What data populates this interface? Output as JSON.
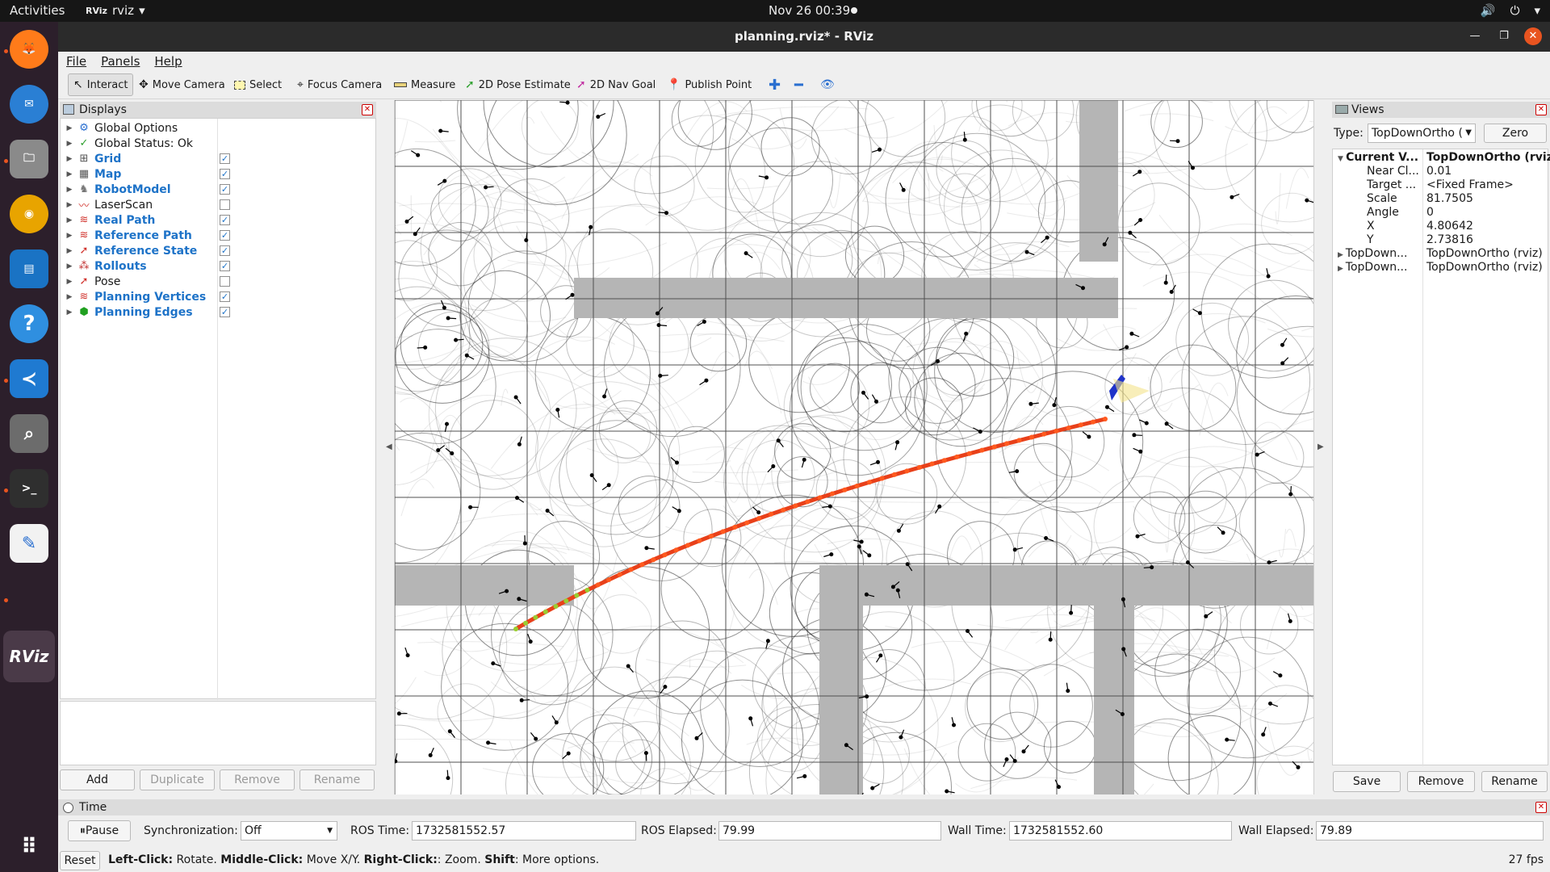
{
  "topbar": {
    "activities": "Activities",
    "app_logo": "RViz",
    "app_name": "rviz",
    "clock": "Nov 26  00:39"
  },
  "window": {
    "title": "planning.rviz* - RViz"
  },
  "menu": [
    "File",
    "Panels",
    "Help"
  ],
  "toolbar": {
    "interact": "Interact",
    "move_camera": "Move Camera",
    "select": "Select",
    "focus_camera": "Focus Camera",
    "measure": "Measure",
    "pose_estimate": "2D Pose Estimate",
    "nav_goal": "2D Nav Goal",
    "publish_point": "Publish Point"
  },
  "displays": {
    "title": "Displays",
    "items": [
      {
        "label": "Global Options",
        "checked": null,
        "highlight": false,
        "icon": "gear-icon"
      },
      {
        "label": "Global Status: Ok",
        "checked": null,
        "highlight": false,
        "icon": "check-icon"
      },
      {
        "label": "Grid",
        "checked": true,
        "highlight": true,
        "icon": "grid-icon"
      },
      {
        "label": "Map",
        "checked": true,
        "highlight": true,
        "icon": "map-icon"
      },
      {
        "label": "RobotModel",
        "checked": true,
        "highlight": true,
        "icon": "robot-icon"
      },
      {
        "label": "LaserScan",
        "checked": false,
        "highlight": false,
        "icon": "laser-icon"
      },
      {
        "label": "Real Path",
        "checked": true,
        "highlight": true,
        "icon": "path-icon"
      },
      {
        "label": "Reference Path",
        "checked": true,
        "highlight": true,
        "icon": "path-icon"
      },
      {
        "label": "Reference State",
        "checked": true,
        "highlight": true,
        "icon": "pose-icon"
      },
      {
        "label": "Rollouts",
        "checked": true,
        "highlight": true,
        "icon": "markers-icon"
      },
      {
        "label": "Pose",
        "checked": false,
        "highlight": false,
        "icon": "pose-icon"
      },
      {
        "label": "Planning Vertices",
        "checked": true,
        "highlight": true,
        "icon": "path-icon"
      },
      {
        "label": "Planning Edges",
        "checked": true,
        "highlight": true,
        "icon": "cube-icon"
      }
    ],
    "buttons": {
      "add": "Add",
      "duplicate": "Duplicate",
      "remove": "Remove",
      "rename": "Rename"
    }
  },
  "views": {
    "title": "Views",
    "type_label": "Type:",
    "type_value": "TopDownOrtho (",
    "zero": "Zero",
    "current": {
      "key": "Current V...",
      "value": "TopDownOrtho (rviz)"
    },
    "props": [
      {
        "key": "Near Cl...",
        "value": "0.01"
      },
      {
        "key": "Target ...",
        "value": "<Fixed Frame>"
      },
      {
        "key": "Scale",
        "value": "81.7505"
      },
      {
        "key": "Angle",
        "value": "0"
      },
      {
        "key": "X",
        "value": "4.80642"
      },
      {
        "key": "Y",
        "value": "2.73816"
      }
    ],
    "saved": [
      {
        "key": "TopDown...",
        "value": "TopDownOrtho (rviz)"
      },
      {
        "key": "TopDown...",
        "value": "TopDownOrtho (rviz)"
      }
    ],
    "buttons": {
      "save": "Save",
      "remove": "Remove",
      "rename": "Rename"
    }
  },
  "time": {
    "title": "Time",
    "pause": "Pause",
    "sync_label": "Synchronization:",
    "sync_value": "Off",
    "ros_time_label": "ROS Time:",
    "ros_time": "1732581552.57",
    "ros_elapsed_label": "ROS Elapsed:",
    "ros_elapsed": "79.99",
    "wall_time_label": "Wall Time:",
    "wall_time": "1732581552.60",
    "wall_elapsed_label": "Wall Elapsed:",
    "wall_elapsed": "79.89"
  },
  "status": {
    "reset": "Reset",
    "lc": "Left-Click:",
    "lc_t": "Rotate.",
    "mc": "Middle-Click:",
    "mc_t": "Move X/Y.",
    "rc": "Right-Click:",
    "rc_t": ": Zoom.",
    "sh": "Shift",
    "sh_t": ": More options.",
    "fps": "27 fps"
  },
  "colors": {
    "highlight": "#1e73c8",
    "path": "#e8401a",
    "obstacle": "#b5b5b5",
    "ubuntu_orange": "#e95420"
  }
}
